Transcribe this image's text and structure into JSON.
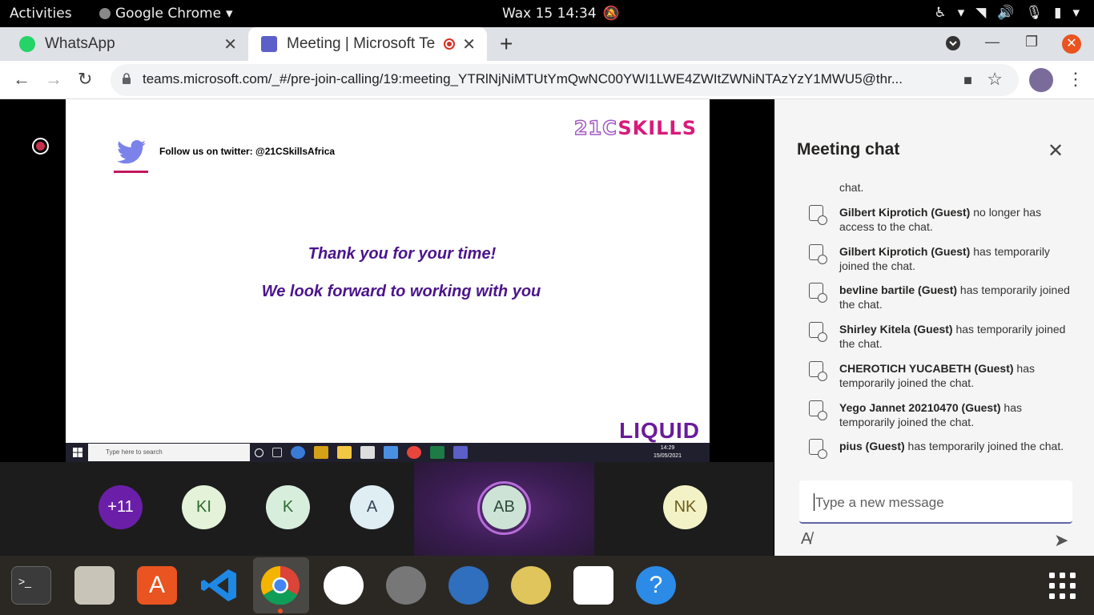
{
  "topbar": {
    "activities": "Activities",
    "app_name": "Google Chrome",
    "clock": "Wax 15  14:34"
  },
  "browser": {
    "tabs": [
      {
        "title": "WhatsApp",
        "icon": "whatsapp-icon"
      },
      {
        "title": "Meeting | Microsoft Te",
        "icon": "teams-icon",
        "recording": true
      }
    ],
    "url": "teams.microsoft.com/_#/pre-join-calling/19:meeting_YTRlNjNiMTUtYmQwNC00YWI1LWE4ZWItZWNiNTAzYzY1MWU5@thr..."
  },
  "slide": {
    "brand_prefix": "21C",
    "brand_suffix": "SKILLS",
    "follow_text": "Follow us on twitter: @21CSkillsAfrica",
    "line1": "Thank you for your time!",
    "line2": "We look forward to working with you",
    "footer_logo": "LIQUID"
  },
  "shared_taskbar": {
    "search_placeholder": "Type here to search",
    "time": "14:29",
    "date": "15/05/2021"
  },
  "participants": [
    {
      "initials": "+11",
      "bg": "#6b1fa8",
      "fg": "#ffffff"
    },
    {
      "initials": "KI",
      "bg": "#e3f2d9",
      "fg": "#2e6b2e"
    },
    {
      "initials": "K",
      "bg": "#d8eedd",
      "fg": "#2e6b2e"
    },
    {
      "initials": "A",
      "bg": "#deeef2",
      "fg": "#345"
    },
    {
      "initials": "AB",
      "bg": "#cde3d5",
      "fg": "#2c4a3a"
    },
    {
      "initials": "NK",
      "bg": "#f3f2c7",
      "fg": "#6b5d1a"
    }
  ],
  "chat": {
    "title": "Meeting chat",
    "truncated_top": "chat.",
    "events": [
      {
        "name": "Gilbert Kiprotich (Guest)",
        "text": " no longer has access to the chat."
      },
      {
        "name": "Gilbert Kiprotich (Guest)",
        "text": " has temporarily joined the chat."
      },
      {
        "name": "bevline bartile (Guest)",
        "text": " has temporarily joined the chat."
      },
      {
        "name": "Shirley Kitela (Guest)",
        "text": " has temporarily joined the chat."
      },
      {
        "name": "CHEROTICH YUCABETH (Guest)",
        "text": " has temporarily joined the chat."
      },
      {
        "name": "Yego Jannet 20210470 (Guest)",
        "text": " has temporarily joined the chat."
      },
      {
        "name": "pius (Guest)",
        "text": " has temporarily joined the chat."
      }
    ],
    "composer_placeholder": "Type a new message"
  },
  "dock": {
    "apps": [
      "terminal-icon",
      "files-icon",
      "software-center-icon",
      "vscode-icon",
      "chrome-icon",
      "slack-icon",
      "settings-icon",
      "thunderbird-icon",
      "rhythmbox-icon",
      "libreoffice-writer-icon",
      "help-icon"
    ]
  }
}
